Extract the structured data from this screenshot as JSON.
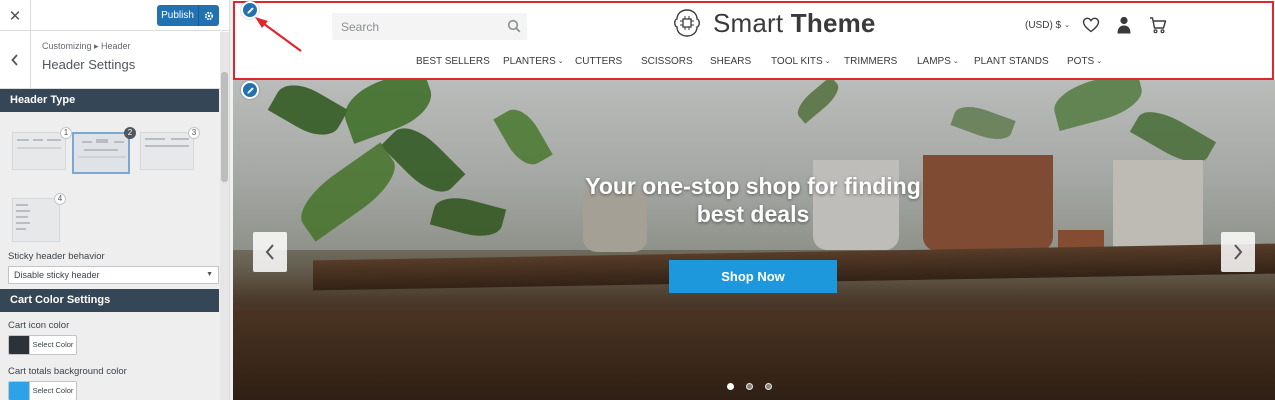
{
  "customizer": {
    "publish_label": "Publish",
    "breadcrumb": "Customizing ▸ Header",
    "section_title": "Header Settings",
    "header_type_heading": "Header Type",
    "layout_options": [
      "1",
      "2",
      "3",
      "4"
    ],
    "selected_layout": "2",
    "sticky_label": "Sticky header behavior",
    "sticky_value": "Disable sticky header",
    "cart_heading": "Cart Color Settings",
    "cart_icon_label": "Cart icon color",
    "cart_icon_color": "#2c3338",
    "cart_totals_label": "Cart totals background color",
    "cart_totals_color": "#2ea2e8",
    "select_color_label": "Select Color"
  },
  "site": {
    "search_placeholder": "Search",
    "logo_light": "Smart",
    "logo_bold": "Theme",
    "currency": "(USD) $",
    "nav": [
      {
        "label": "BEST SELLERS",
        "caret": false
      },
      {
        "label": "PLANTERS",
        "caret": true
      },
      {
        "label": "CUTTERS",
        "caret": false
      },
      {
        "label": "SCISSORS",
        "caret": false
      },
      {
        "label": "SHEARS",
        "caret": false
      },
      {
        "label": "TOOL KITS",
        "caret": true
      },
      {
        "label": "TRIMMERS",
        "caret": false
      },
      {
        "label": "LAMPS",
        "caret": true
      },
      {
        "label": "PLANT STANDS",
        "caret": false
      },
      {
        "label": "POTS",
        "caret": true
      }
    ],
    "hero_title_line1": "Your one-stop shop for finding",
    "hero_title_line2": "best deals",
    "hero_button": "Shop Now",
    "slide_count": 3,
    "active_slide": 1
  },
  "colors": {
    "accent": "#2271b1",
    "highlight_outline": "#e0262c",
    "shop_button": "#1e98dc",
    "section_heading_bg": "#354657"
  },
  "icons": [
    "close-icon",
    "gear-icon",
    "chevron-left-icon",
    "search-icon",
    "brain-chip-icon",
    "heart-icon",
    "user-icon",
    "cart-icon",
    "pencil-icon",
    "chevron-right-icon"
  ]
}
